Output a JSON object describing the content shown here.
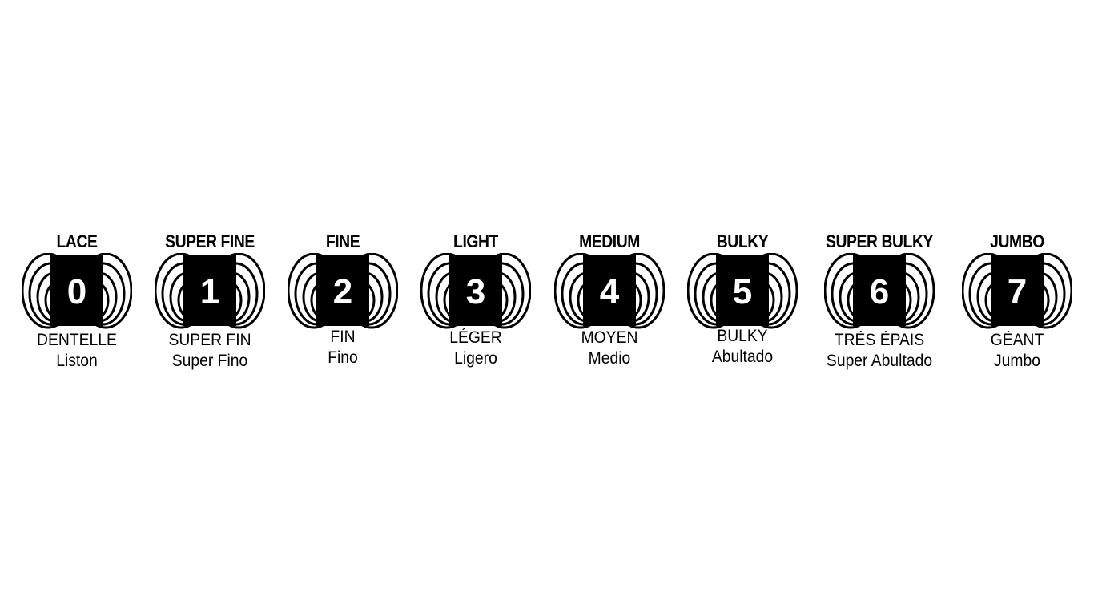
{
  "chart_data": {
    "type": "table",
    "title": "",
    "items": [
      {
        "number": "0",
        "name": "LACE",
        "french": "DENTELLE",
        "spanish": "Liston"
      },
      {
        "number": "1",
        "name": "SUPER FINE",
        "french": "SUPER FIN",
        "spanish": "Super Fino"
      },
      {
        "number": "2",
        "name": "FINE",
        "french": "FIN",
        "spanish": "Fino"
      },
      {
        "number": "3",
        "name": "LIGHT",
        "french": "LÉGER",
        "spanish": "Ligero"
      },
      {
        "number": "4",
        "name": "MEDIUM",
        "french": "MOYEN",
        "spanish": "Medio"
      },
      {
        "number": "5",
        "name": "BULKY",
        "french": "BULKY",
        "spanish": "Abultado"
      },
      {
        "number": "6",
        "name": "SUPER BULKY",
        "french": "TRÉS ÉPAIS",
        "spanish": "Super Abultado"
      },
      {
        "number": "7",
        "name": "JUMBO",
        "french": "GÉANT",
        "spanish": "Jumbo"
      }
    ]
  },
  "colors": {
    "ink": "#000000",
    "paper": "#ffffff"
  }
}
